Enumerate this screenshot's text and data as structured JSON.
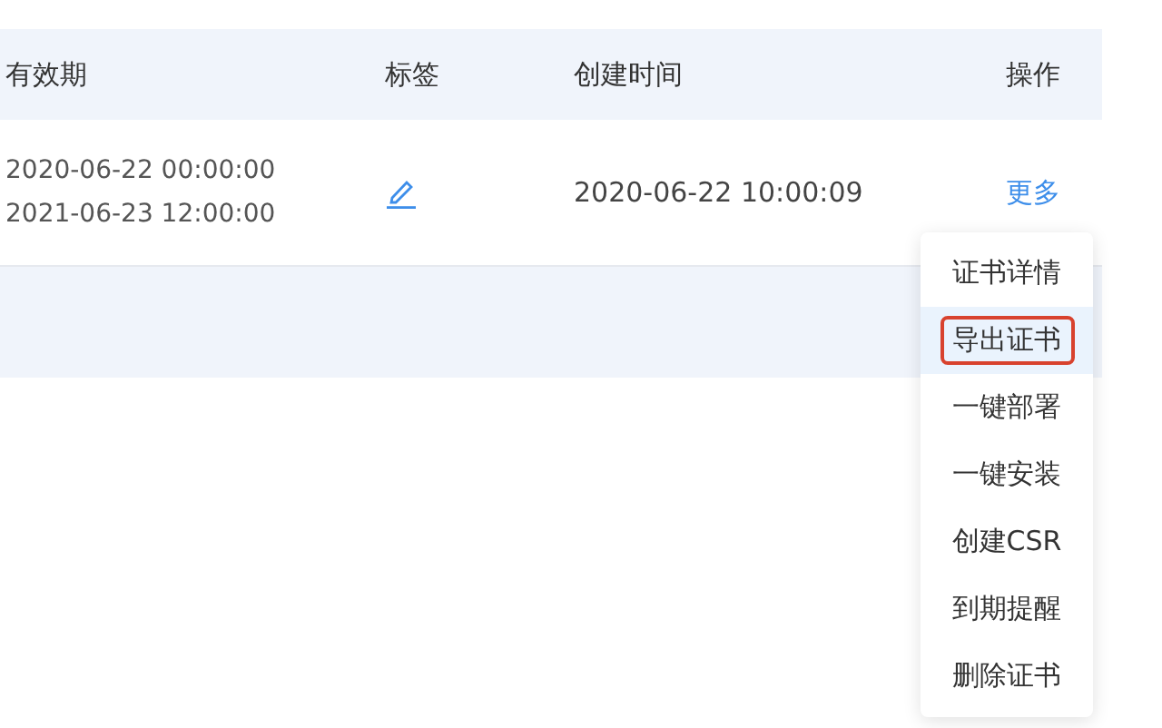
{
  "table": {
    "columns": [
      "有效期",
      "标签",
      "创建时间",
      "操作"
    ],
    "rows": [
      {
        "validity": [
          "2020-06-22 00:00:00",
          "2021-06-23 12:00:00"
        ],
        "created": "2020-06-22 10:00:09",
        "action": "更多"
      }
    ]
  },
  "menu": {
    "items": [
      {
        "label": "证书详情",
        "highlighted": false
      },
      {
        "label": "导出证书",
        "highlighted": true
      },
      {
        "label": "一键部署",
        "highlighted": false
      },
      {
        "label": "一键安装",
        "highlighted": false
      },
      {
        "label": "创建CSR",
        "highlighted": false
      },
      {
        "label": "到期提醒",
        "highlighted": false
      },
      {
        "label": "删除证书",
        "highlighted": false
      }
    ]
  }
}
